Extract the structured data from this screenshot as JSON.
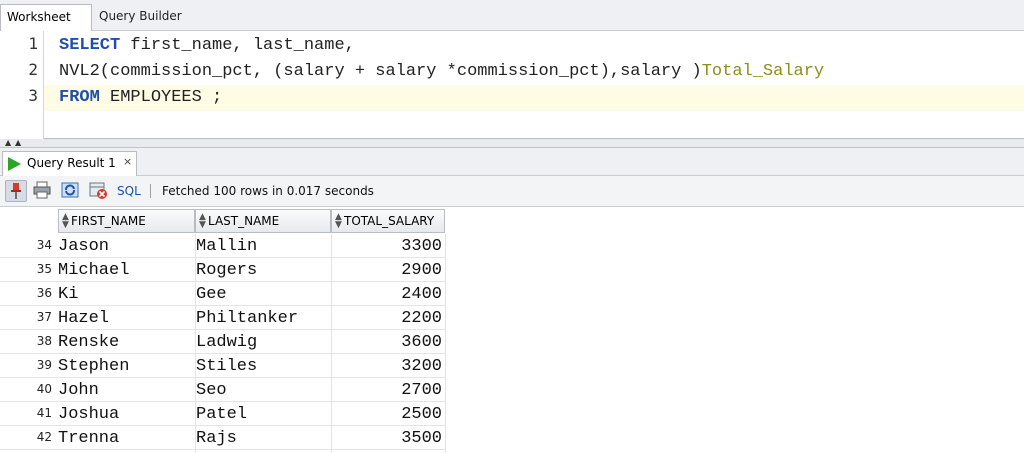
{
  "tabs": {
    "worksheet": "Worksheet",
    "query_builder": "Query Builder"
  },
  "editor": {
    "lines": [
      {
        "num": "1",
        "kw1": "SELECT",
        "rest": " first_name, last_name,"
      },
      {
        "num": "2",
        "text": "NVL2(commission_pct, (salary + salary *commission_pct),salary )",
        "alias": "Total_Salary"
      },
      {
        "num": "3",
        "kw1": "FROM",
        "rest": " EMPLOYEES ;"
      }
    ]
  },
  "result": {
    "tab_label": "Query Result 1",
    "close_label": "×",
    "toolbar": {
      "sql_label": "SQL",
      "status": "Fetched 100 rows in 0.017 seconds"
    },
    "columns": [
      "FIRST_NAME",
      "LAST_NAME",
      "TOTAL_SALARY"
    ],
    "rows": [
      {
        "n": "34",
        "first": "Jason",
        "last": "Mallin",
        "salary": "3300"
      },
      {
        "n": "35",
        "first": "Michael",
        "last": "Rogers",
        "salary": "2900"
      },
      {
        "n": "36",
        "first": "Ki",
        "last": "Gee",
        "salary": "2400"
      },
      {
        "n": "37",
        "first": "Hazel",
        "last": "Philtanker",
        "salary": "2200"
      },
      {
        "n": "38",
        "first": "Renske",
        "last": "Ladwig",
        "salary": "3600"
      },
      {
        "n": "39",
        "first": "Stephen",
        "last": "Stiles",
        "salary": "3200"
      },
      {
        "n": "40",
        "first": "John",
        "last": "Seo",
        "salary": "2700"
      },
      {
        "n": "41",
        "first": "Joshua",
        "last": "Patel",
        "salary": "2500"
      },
      {
        "n": "42",
        "first": "Trenna",
        "last": "Rajs",
        "salary": "3500"
      }
    ]
  },
  "icons": {
    "pin": "pin-icon",
    "print": "print-icon",
    "refresh": "refresh-icon",
    "clear": "clear-icon",
    "run": "run-icon"
  },
  "colors": {
    "keyword": "#1f4fa8",
    "alias": "#8d8d1a",
    "current_line": "#fffce6",
    "run_green": "#2aa52a"
  }
}
